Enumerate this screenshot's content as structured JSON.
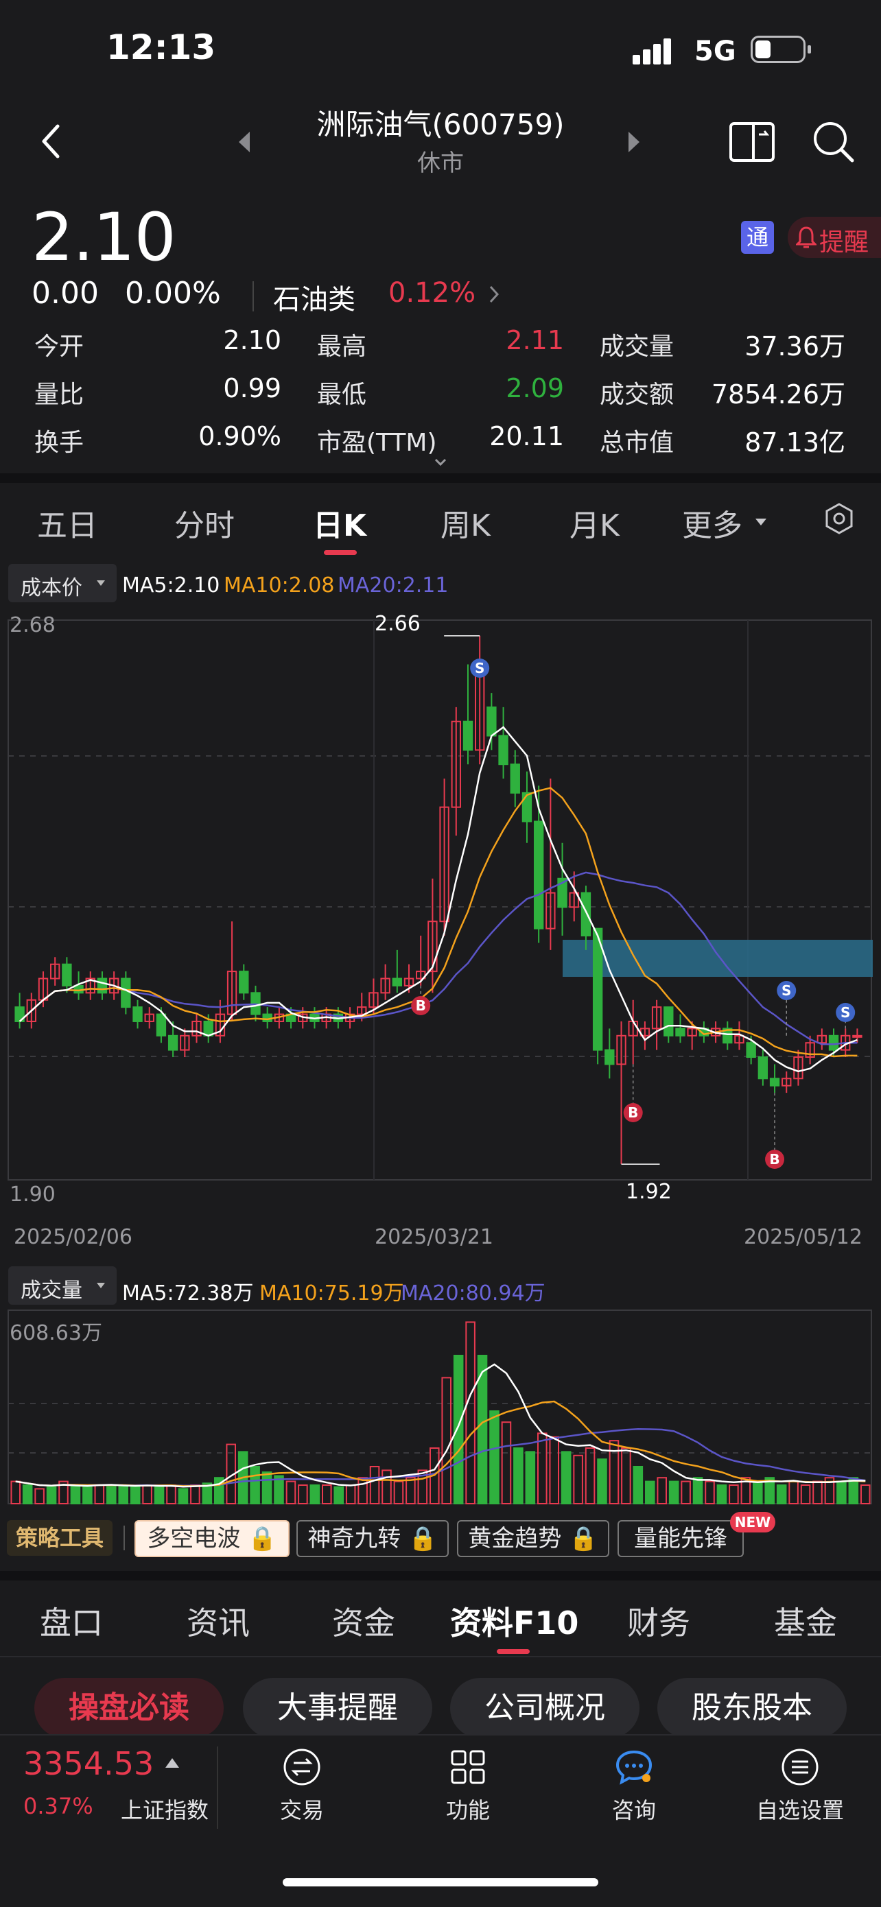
{
  "status_bar": {
    "time": "12:13",
    "network": "5G"
  },
  "header": {
    "title": "洲际油气(600759)",
    "subtitle": "休市"
  },
  "quote": {
    "price": "2.10",
    "change": "0.00",
    "change_pct": "0.00%",
    "sector": "石油类",
    "sector_pct": "0.12%",
    "tong_badge": "通",
    "alert_label": "提醒"
  },
  "stats": [
    [
      {
        "label": "今开",
        "value": "2.10",
        "color": "white"
      },
      {
        "label": "最高",
        "value": "2.11",
        "color": "red"
      },
      {
        "label": "成交量",
        "value": "37.36万",
        "color": "white"
      }
    ],
    [
      {
        "label": "量比",
        "value": "0.99",
        "color": "white"
      },
      {
        "label": "最低",
        "value": "2.09",
        "color": "green"
      },
      {
        "label": "成交额",
        "value": "7854.26万",
        "color": "white"
      }
    ],
    [
      {
        "label": "换手",
        "value": "0.90%",
        "color": "white"
      },
      {
        "label": "市盈(TTM)",
        "value": "20.11",
        "color": "white"
      },
      {
        "label": "总市值",
        "value": "87.13亿",
        "color": "white"
      }
    ]
  ],
  "k_tabs": [
    "五日",
    "分时",
    "日K",
    "周K",
    "月K",
    "更多"
  ],
  "k_active": "日K",
  "price_chart": {
    "selector": "成本价",
    "ma5": "MA5:2.10",
    "ma10": "MA10:2.08",
    "ma20": "MA20:2.11",
    "y_max_label": "2.68",
    "y_min_label": "1.90",
    "high_mark": "2.66",
    "low_mark": "1.92",
    "dates": [
      "2025/02/06",
      "2025/03/21",
      "2025/05/12"
    ]
  },
  "volume_chart": {
    "selector": "成交量",
    "ma5": "MA5:72.38万",
    "ma10": "MA10:75.19万",
    "ma20": "MA20:80.94万",
    "y_max_label": "608.63万"
  },
  "strategy": {
    "label": "策略工具",
    "chips": [
      "多空电波",
      "神奇九转",
      "黄金趋势",
      "量能先锋"
    ],
    "new_badge": "NEW"
  },
  "f10_tabs": [
    "盘口",
    "资讯",
    "资金",
    "资料F10",
    "财务",
    "基金"
  ],
  "f10_active": "资料F10",
  "sub_pills": [
    "操盘必读",
    "大事提醒",
    "公司概况",
    "股东股本"
  ],
  "bottom_nav": {
    "index_value": "3354.53",
    "index_pct": "0.37%",
    "index_name": "上证指数",
    "items": [
      {
        "label": "交易",
        "icon": "exchange-icon"
      },
      {
        "label": "功能",
        "icon": "grid-icon"
      },
      {
        "label": "咨询",
        "icon": "chat-icon"
      },
      {
        "label": "自选设置",
        "icon": "list-settings-icon"
      }
    ]
  },
  "colors": {
    "up": "#e83a4f",
    "down": "#2fb13e",
    "ma5": "#ffffff",
    "ma10": "#f4a21c",
    "ma20": "#5b55c8",
    "zone": "#2a6d8c"
  }
}
